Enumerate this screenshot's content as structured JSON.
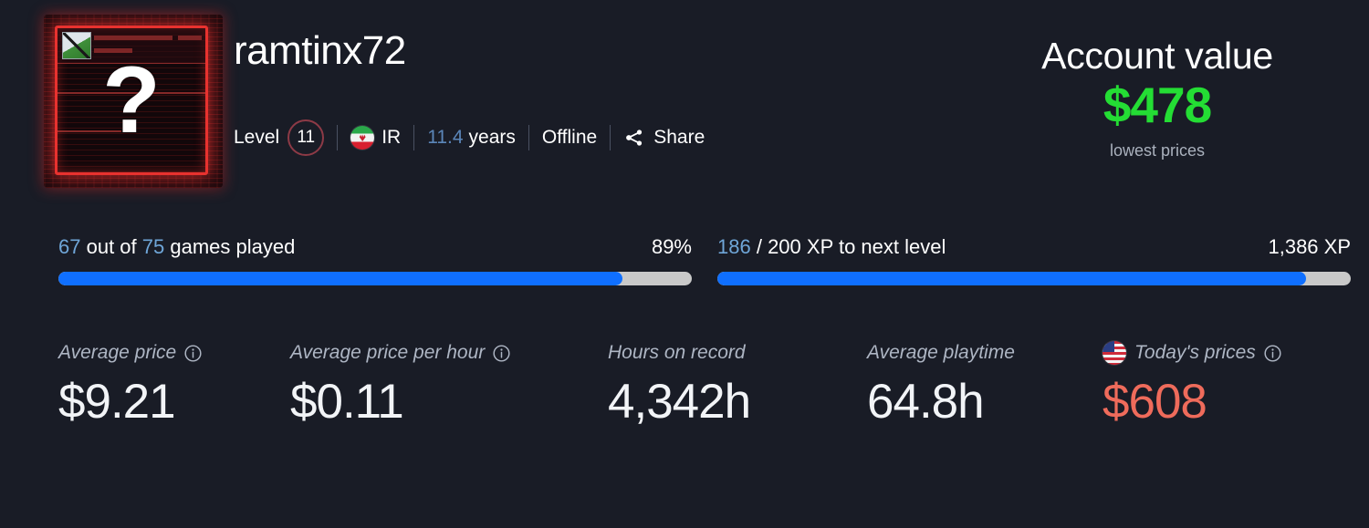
{
  "theme": {
    "background": "#191c26",
    "accent_blue": "#0f6fff",
    "link_blue": "#6fa6d8",
    "muted_blue": "#5b86b9",
    "green": "#24dd34",
    "red": "#ef6b5b",
    "track_gray": "#c9c9c9",
    "label_gray": "#aeb6c4",
    "avatar_frame_red": "#e8322f"
  },
  "profile": {
    "username": "ramtinx72",
    "avatar": {
      "icon": "broken-image-placeholder",
      "glyph": "?"
    },
    "meta": {
      "level_label": "Level",
      "level_value": "11",
      "country_code": "IR",
      "country_flag_icon": "flag-ir-icon",
      "years_value": "11.4",
      "years_word": "years",
      "status": "Offline",
      "share_label": "Share",
      "share_icon": "share-icon"
    }
  },
  "account_value": {
    "title": "Account value",
    "amount": "$478",
    "note": "lowest prices"
  },
  "progress": [
    {
      "id": "games-played",
      "prefix_value": "67",
      "middle_text": " out of ",
      "second_value": "75",
      "suffix_text": " games played",
      "right_text": "89%",
      "percent": 89
    },
    {
      "id": "xp-to-next-level",
      "prefix_value": "186",
      "middle_text": " / ",
      "second_value": "200",
      "suffix_text": " XP to next level",
      "right_text": "1,386 XP",
      "percent": 93
    }
  ],
  "stats": [
    {
      "id": "average-price",
      "label": "Average price",
      "value": "$9.21",
      "has_info_icon": true,
      "info_icon": "info-circle-icon",
      "flag_icon": null,
      "value_color": "default"
    },
    {
      "id": "average-price-per-hour",
      "label": "Average price per hour",
      "value": "$0.11",
      "has_info_icon": true,
      "info_icon": "info-circle-icon",
      "flag_icon": null,
      "value_color": "default"
    },
    {
      "id": "hours-on-record",
      "label": "Hours on record",
      "value": "4,342h",
      "has_info_icon": false,
      "info_icon": null,
      "flag_icon": null,
      "value_color": "default"
    },
    {
      "id": "average-playtime",
      "label": "Average playtime",
      "value": "64.8h",
      "has_info_icon": false,
      "info_icon": null,
      "flag_icon": null,
      "value_color": "default"
    },
    {
      "id": "todays-prices",
      "label": "Today's prices",
      "value": "$608",
      "has_info_icon": true,
      "info_icon": "info-circle-icon",
      "flag_icon": "flag-us-icon",
      "value_color": "red"
    }
  ]
}
